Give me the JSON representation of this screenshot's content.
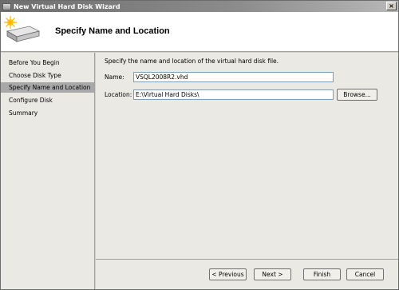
{
  "window": {
    "title": "New Virtual Hard Disk Wizard",
    "close_glyph": "×"
  },
  "header": {
    "title": "Specify Name and Location",
    "icon": "hard-disk-with-sparkle-icon"
  },
  "steps": [
    {
      "label": "Before You Begin",
      "active": false
    },
    {
      "label": "Choose Disk Type",
      "active": false
    },
    {
      "label": "Specify Name and Location",
      "active": true
    },
    {
      "label": "Configure Disk",
      "active": false
    },
    {
      "label": "Summary",
      "active": false
    }
  ],
  "form": {
    "intro": "Specify the name and location of the virtual hard disk file.",
    "name_label": "Name:",
    "name_value": "VSQL2008R2.vhd",
    "location_label": "Location:",
    "location_value": "E:\\Virtual Hard Disks\\",
    "browse_label": "Browse..."
  },
  "buttons": {
    "previous": "< Previous",
    "next": "Next >",
    "finish": "Finish",
    "cancel": "Cancel"
  }
}
